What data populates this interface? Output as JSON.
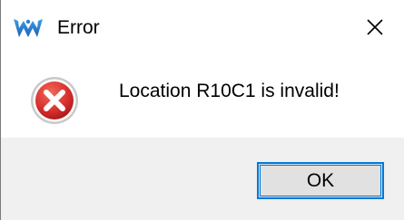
{
  "window": {
    "title": "Error",
    "app_icon": "gowin-logo-icon",
    "close_icon": "close-icon"
  },
  "content": {
    "icon": "error-icon",
    "message": "Location R10C1 is invalid!"
  },
  "buttons": {
    "ok_label": "OK"
  },
  "colors": {
    "accent": "#0078d7",
    "error_red": "#d9322f",
    "footer_bg": "#f0f0f0",
    "button_bg": "#e1e1e1"
  }
}
